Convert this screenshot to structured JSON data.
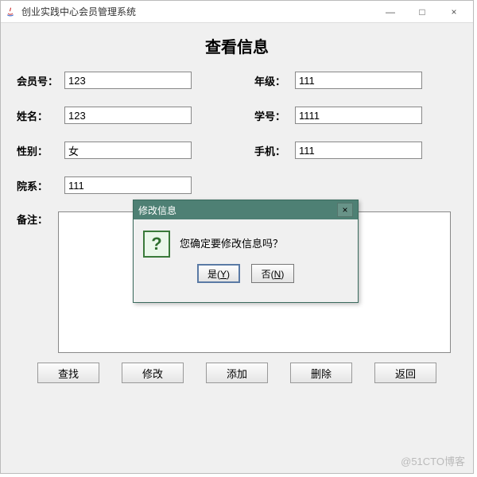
{
  "window": {
    "title": "创业实践中心会员管理系统",
    "controls": {
      "min": "—",
      "max": "□",
      "close": "×"
    }
  },
  "page_title": "查看信息",
  "labels": {
    "member_id": "会员号：",
    "grade": "年级：",
    "name": "姓名：",
    "student_id": "学号：",
    "gender": "性别：",
    "phone": "手机：",
    "dept": "院系：",
    "remark": "备注："
  },
  "values": {
    "member_id": "123",
    "grade": "111",
    "name": "123",
    "student_id": "1111",
    "gender": "女",
    "phone": "111",
    "dept": "111",
    "remark": ""
  },
  "buttons": {
    "search": "查找",
    "modify": "修改",
    "add": "添加",
    "delete": "删除",
    "back": "返回"
  },
  "dialog": {
    "title": "修改信息",
    "message": "您确定要修改信息吗？",
    "yes": "是",
    "yes_mnemonic": "Y",
    "no": "否",
    "no_mnemonic": "N",
    "close": "×",
    "icon_glyph": "?"
  },
  "watermark": "@51CTO博客"
}
